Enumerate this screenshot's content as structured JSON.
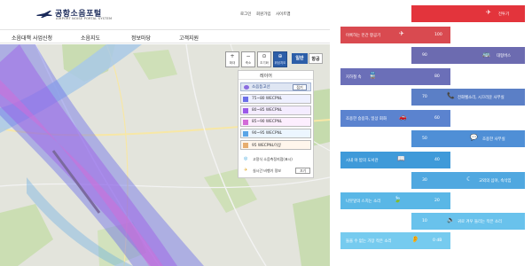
{
  "header": {
    "logo_title": "공항소음포털",
    "logo_sub": "AIRPORT NOISE PORTAL SYSTEM",
    "util_links": [
      "로그인",
      "회원가입",
      "사이트맵"
    ]
  },
  "nav": {
    "items": [
      "소음대책 사업신청",
      "소음지도",
      "정보마당",
      "고객지원"
    ]
  },
  "map": {
    "controls": [
      {
        "icon": "+",
        "label": "확대"
      },
      {
        "icon": "−",
        "label": "축소"
      },
      {
        "icon": "⊙",
        "label": "초기화"
      },
      {
        "icon": "⊕",
        "label": "위성지도"
      }
    ],
    "view_buttons": [
      "일반",
      "항공"
    ]
  },
  "legend": {
    "title": "레이어",
    "head_label": "소음등고선",
    "head_button": "접기",
    "rows": [
      {
        "label": "75~80 WECPNL",
        "color": "#6b6ee8",
        "bg": "#eef0ff"
      },
      {
        "label": "80~85 WECPNL",
        "color": "#9b59e8",
        "bg": "#f4ecff"
      },
      {
        "label": "85~90 WECPNL",
        "color": "#d36bd8",
        "bg": "#fdeefe"
      },
      {
        "label": "90~95 WECPNL",
        "color": "#5aa5e6",
        "bg": "#ecf6ff"
      },
      {
        "label": "95 WECPNL이상",
        "color": "#e6ad6f",
        "bg": "#fff6ec"
      }
    ],
    "extras": [
      {
        "icon": "◎",
        "label": "고정식 소음측정지점(표시)",
        "button": ""
      },
      {
        "icon": "✈",
        "label": "실시간 비행기 정보",
        "button": "끄기"
      }
    ]
  },
  "infographic": {
    "bars": [
      {
        "text": "전투기",
        "value": "",
        "color": "#e3343c",
        "icon": "✈"
      },
      {
        "text": "이륙하는 민간 항공기",
        "value": "100",
        "color": "#d94a50",
        "icon": "✈"
      },
      {
        "text": "대형버스",
        "value": "90",
        "color": "#6c6bb0",
        "icon": "🚌"
      },
      {
        "text": "지하철 속",
        "value": "80",
        "color": "#6b6fb8",
        "icon": "🚆"
      },
      {
        "text": "전화벨소리, 시끄러운 사무실",
        "value": "70",
        "color": "#5b7fc6",
        "icon": "📞"
      },
      {
        "text": "조용한 승용차, 일상 회화",
        "value": "60",
        "color": "#5b83cf",
        "icon": "🚗"
      },
      {
        "text": "조용한 사무실",
        "value": "50",
        "color": "#4f8fd6",
        "icon": "💬"
      },
      {
        "text": "시내 야 밤의 도서관",
        "value": "40",
        "color": "#3f9ad9",
        "icon": "📖"
      },
      {
        "text": "교외의 심야, 속삭임",
        "value": "30",
        "color": "#50a8e0",
        "icon": "☾"
      },
      {
        "text": "나뭇잎의 스치는 소리",
        "value": "20",
        "color": "#5ab7e6",
        "icon": "🍃"
      },
      {
        "text": "귀로 겨우 들리는 작은 소리",
        "value": "10",
        "color": "#69c2ec",
        "icon": "🔈"
      },
      {
        "text": "들을 수 없는 가장 작은 소리",
        "value": "0 dB",
        "color": "#76cbef",
        "icon": "👂"
      }
    ]
  }
}
